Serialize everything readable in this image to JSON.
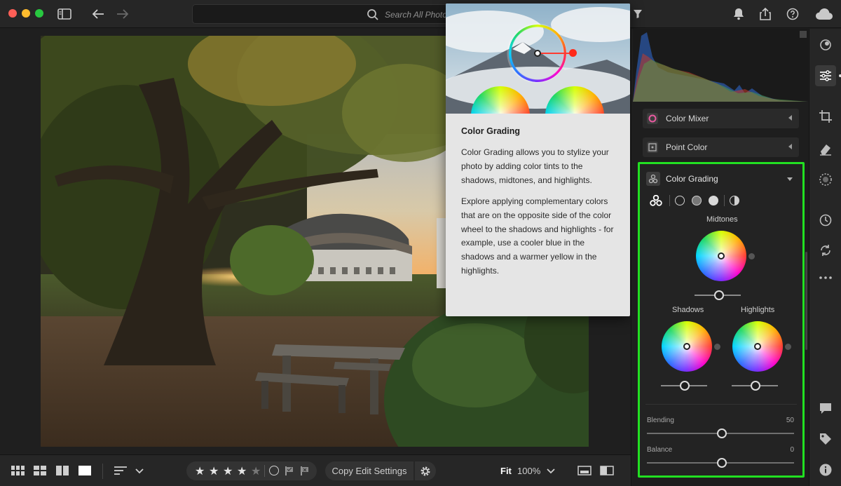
{
  "window": {
    "traffic_lights": [
      "close",
      "minimize",
      "zoom"
    ]
  },
  "topbar": {
    "search_placeholder": "Search All Photos",
    "icons": [
      "panel-toggle-icon",
      "back-icon",
      "forward-icon",
      "filter-icon",
      "bell-icon",
      "share-icon",
      "help-icon",
      "cloud-icon"
    ]
  },
  "tooltip": {
    "title": "Color Grading",
    "paragraph1": "Color Grading allows you to stylize your photo by adding color tints to the shadows, midtones, and highlights.",
    "paragraph2": "Explore applying complementary colors that are on the opposite side of the color wheel to the shadows and highlights - for example, use a cooler blue in the shadows and a warmer yellow in the highlights."
  },
  "panel": {
    "sections": [
      {
        "label": "Color Mixer"
      },
      {
        "label": "Point Color"
      }
    ],
    "color_grading": {
      "label": "Color Grading",
      "midtones_label": "Midtones",
      "shadows_label": "Shadows",
      "highlights_label": "Highlights",
      "blending_label": "Blending",
      "blending_value": "50",
      "balance_label": "Balance",
      "balance_value": "0"
    }
  },
  "bottombar": {
    "rating": 4,
    "max_rating": 5,
    "copy_label": "Copy Edit Settings",
    "fit_label": "Fit",
    "zoom_label": "100%"
  },
  "colors": {
    "highlight_border": "#22e022",
    "panel_bg": "#1e1e1e",
    "tooltip_bg": "#e5e5e5"
  }
}
